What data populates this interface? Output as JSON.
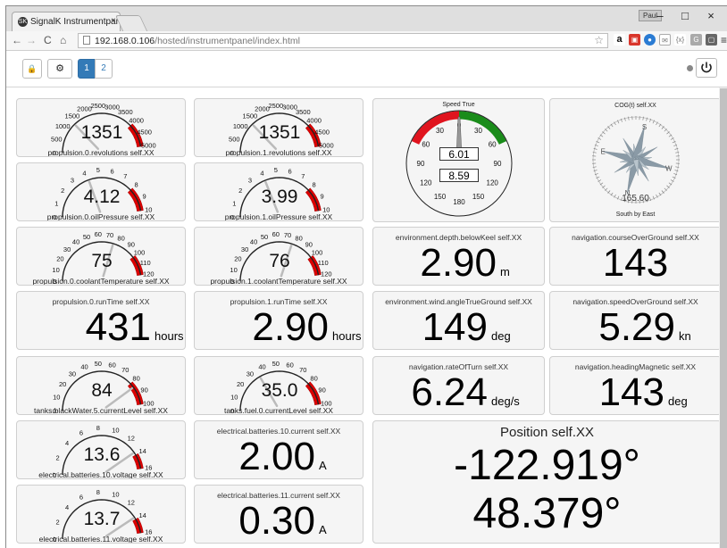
{
  "browser": {
    "tab_title": "SignalK Instrumentpanel",
    "tab_close": "×",
    "favicon": "SK",
    "user_badge": "Paul",
    "win_min": "–",
    "win_max": "□",
    "win_close": "×",
    "url_host": "192.168.0.106",
    "url_path": "/hosted/instrumentpanel/index.html",
    "icons": [
      "back-arrow-icon",
      "forward-arrow-icon",
      "reload-icon",
      "home-icon",
      "star-icon",
      "menu-icon"
    ]
  },
  "toolbar": {
    "lock_glyph": "🔒",
    "settings_glyph": "⚙",
    "pages": [
      "1",
      "2"
    ],
    "active_page": "1"
  },
  "gauges": [
    {
      "label": "propulsion.0.revolutions self.XX",
      "value": "1351",
      "ticks": [
        "0",
        "500",
        "1000",
        "1500",
        "2000",
        "2500",
        "3000",
        "3500",
        "4000",
        "4500",
        "5000"
      ],
      "min": 0,
      "max": 5000,
      "current": 1351,
      "red_from": 4000
    },
    {
      "label": "propulsion.1.revolutions self.XX",
      "value": "1351",
      "ticks": [
        "0",
        "500",
        "1000",
        "1500",
        "2000",
        "2500",
        "3000",
        "3500",
        "4000",
        "4500",
        "5000"
      ],
      "min": 0,
      "max": 5000,
      "current": 1351,
      "red_from": 4000
    },
    {
      "label": "propulsion.0.oilPressure self.XX",
      "value": "4.12",
      "ticks": [
        "0",
        "1",
        "2",
        "3",
        "4",
        "5",
        "6",
        "7",
        "8",
        "9",
        "10"
      ],
      "min": 0,
      "max": 10,
      "current": 4.12,
      "red_from": 8
    },
    {
      "label": "propulsion.1.oilPressure self.XX",
      "value": "3.99",
      "ticks": [
        "0",
        "1",
        "2",
        "3",
        "4",
        "5",
        "6",
        "7",
        "8",
        "9",
        "10"
      ],
      "min": 0,
      "max": 10,
      "current": 3.99,
      "red_from": 8
    },
    {
      "label": "propulsion.0.coolantTemperature self.XX",
      "value": "75",
      "ticks": [
        "0",
        "10",
        "20",
        "30",
        "40",
        "50",
        "60",
        "70",
        "80",
        "90",
        "100",
        "110",
        "120"
      ],
      "min": 0,
      "max": 120,
      "current": 75,
      "red_from": 100
    },
    {
      "label": "propulsion.1.coolantTemperature self.XX",
      "value": "76",
      "ticks": [
        "0",
        "10",
        "20",
        "30",
        "40",
        "50",
        "60",
        "70",
        "80",
        "90",
        "100",
        "110",
        "120"
      ],
      "min": 0,
      "max": 120,
      "current": 76,
      "red_from": 100
    },
    {
      "label": "tanks.blackWater.5.currentLevel self.XX",
      "value": "84",
      "ticks": [
        "0",
        "10",
        "20",
        "30",
        "40",
        "50",
        "60",
        "70",
        "80",
        "90",
        "100"
      ],
      "min": 0,
      "max": 100,
      "current": 84,
      "red_from": 80
    },
    {
      "label": "tanks.fuel.0.currentLevel self.XX",
      "value": "35.0",
      "ticks": [
        "0",
        "10",
        "20",
        "30",
        "40",
        "50",
        "60",
        "70",
        "80",
        "90",
        "100"
      ],
      "min": 0,
      "max": 100,
      "current": 35,
      "red_from": 80
    },
    {
      "label": "electrical.batteries.10.voltage self.XX",
      "value": "13.6",
      "ticks": [
        "0",
        "2",
        "4",
        "6",
        "8",
        "10",
        "12",
        "14",
        "16"
      ],
      "min": 0,
      "max": 16,
      "current": 13.6,
      "red_from": 14
    },
    {
      "label": "electrical.batteries.11.voltage self.XX",
      "value": "13.7",
      "ticks": [
        "0",
        "2",
        "4",
        "6",
        "8",
        "10",
        "12",
        "14",
        "16"
      ],
      "min": 0,
      "max": 16,
      "current": 13.7,
      "red_from": 14
    }
  ],
  "speed": {
    "title": "Speed True",
    "ticks": [
      "0",
      "30",
      "60",
      "90",
      "120",
      "150",
      "180",
      "150",
      "120",
      "90",
      "60",
      "30"
    ],
    "value1": "6.01",
    "value2": "8.59"
  },
  "cog": {
    "title": "COG(t) self.XX",
    "cardinals": [
      "N",
      "E",
      "S",
      "W"
    ],
    "value": "165.60",
    "caption": "South by East",
    "heading_deg": 165.6
  },
  "numbers": [
    {
      "title": "propulsion.0.runTime self.XX",
      "value": "431",
      "unit": "hours"
    },
    {
      "title": "propulsion.1.runTime self.XX",
      "value": "2.90",
      "unit": "hours"
    },
    {
      "title": "environment.depth.belowKeel self.XX",
      "value": "2.90",
      "unit": "m"
    },
    {
      "title": "navigation.courseOverGround self.XX",
      "value": "143",
      "unit": ""
    },
    {
      "title": "environment.wind.angleTrueGround self.XX",
      "value": "149",
      "unit": "deg"
    },
    {
      "title": "navigation.speedOverGround self.XX",
      "value": "5.29",
      "unit": "kn"
    },
    {
      "title": "navigation.rateOfTurn self.XX",
      "value": "6.24",
      "unit": "deg/s"
    },
    {
      "title": "navigation.headingMagnetic self.XX",
      "value": "143",
      "unit": "deg"
    },
    {
      "title": "electrical.batteries.10.current self.XX",
      "value": "2.00",
      "unit": "A"
    },
    {
      "title": "electrical.batteries.11.current self.XX",
      "value": "0.30",
      "unit": "A"
    }
  ],
  "position": {
    "title": "Position self.XX",
    "longitude": "-122.919°",
    "latitude": "48.379°"
  }
}
